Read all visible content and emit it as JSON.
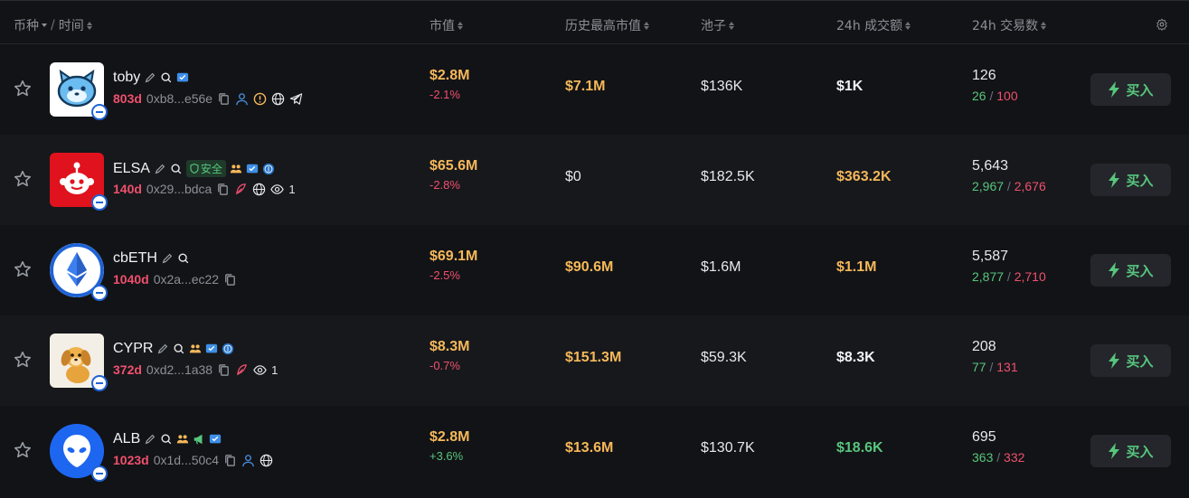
{
  "header": {
    "coin": "币种",
    "time": "时间",
    "market_cap": "市值",
    "ath_market_cap": "历史最高市值",
    "pool": "池子",
    "volume_24h": "24h 成交额",
    "txns_24h": "24h 交易数"
  },
  "buy_label": "买入",
  "safe_label": "安全",
  "colors": {
    "background": "#121316",
    "alt_row": "#17181c",
    "gold": "#f5b85a",
    "green": "#57c67d",
    "red": "#f0506e",
    "muted": "#8b8f97"
  },
  "rows": [
    {
      "name": "toby",
      "age": "803d",
      "address": "0xb8...e56e",
      "market_cap": "$2.8M",
      "change": "-2.1%",
      "ath": "$7.1M",
      "pool": "$136K",
      "volume": "$1K",
      "txns": "126",
      "buys": "26",
      "sells": "100"
    },
    {
      "name": "ELSA",
      "age": "140d",
      "address": "0x29...bdca",
      "views": "1",
      "market_cap": "$65.6M",
      "change": "-2.8%",
      "ath": "$0",
      "pool": "$182.5K",
      "volume": "$363.2K",
      "txns": "5,643",
      "buys": "2,967",
      "sells": "2,676"
    },
    {
      "name": "cbETH",
      "age": "1040d",
      "address": "0x2a...ec22",
      "market_cap": "$69.1M",
      "change": "-2.5%",
      "ath": "$90.6M",
      "pool": "$1.6M",
      "volume": "$1.1M",
      "txns": "5,587",
      "buys": "2,877",
      "sells": "2,710"
    },
    {
      "name": "CYPR",
      "age": "372d",
      "address": "0xd2...1a38",
      "views": "1",
      "market_cap": "$8.3M",
      "change": "-0.7%",
      "ath": "$151.3M",
      "pool": "$59.3K",
      "volume": "$8.3K",
      "txns": "208",
      "buys": "77",
      "sells": "131"
    },
    {
      "name": "ALB",
      "age": "1023d",
      "address": "0x1d...50c4",
      "market_cap": "$2.8M",
      "change": "+3.6%",
      "ath": "$13.6M",
      "pool": "$130.7K",
      "volume": "$18.6K",
      "txns": "695",
      "buys": "363",
      "sells": "332"
    }
  ]
}
